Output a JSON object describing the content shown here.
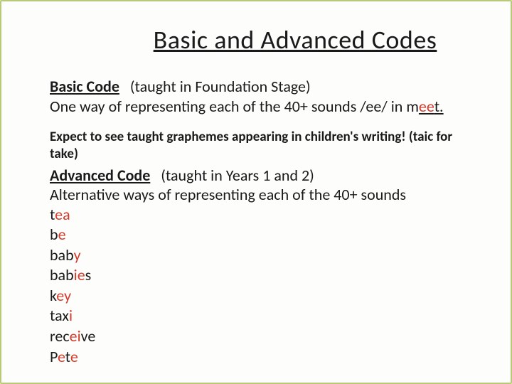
{
  "title": "Basic and Advanced Codes",
  "basic": {
    "heading": "Basic Code",
    "taught": "(taught in Foundation Stage)",
    "desc_pre": "One way of representing each of the 40+ sounds  /ee/   in m",
    "desc_hl": "ee",
    "desc_post": "t."
  },
  "note": "Expect to see taught graphemes appearing in children's writing! (taic for take)",
  "advanced": {
    "heading": "Advanced Code",
    "taught": "(taught in Years 1 and 2)",
    "desc": "Alternative ways of representing each of the 40+ sounds"
  },
  "words": [
    {
      "pre": "t",
      "hl": "ea",
      "post": ""
    },
    {
      "pre": "b",
      "hl": "e",
      "post": ""
    },
    {
      "pre": "bab",
      "hl": "y",
      "post": ""
    },
    {
      "pre": "bab",
      "hl": "ie",
      "post": "s"
    },
    {
      "pre": "k",
      "hl": "ey",
      "post": ""
    },
    {
      "pre": "tax",
      "hl": "i",
      "post": ""
    },
    {
      "pre": "rec",
      "hl": "ei",
      "post": "ve"
    },
    {
      "pre": "P",
      "hl": "e",
      "post": "te",
      "split_hl": "e"
    }
  ]
}
